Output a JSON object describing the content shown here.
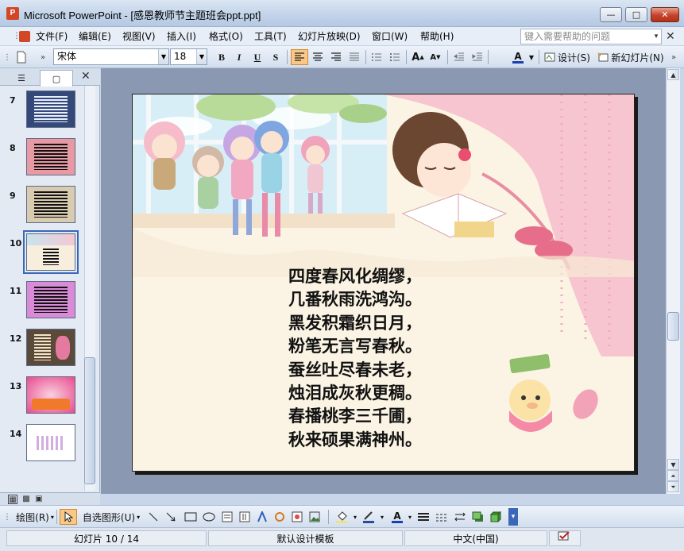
{
  "window": {
    "title": "Microsoft PowerPoint - [感恩教师节主题班会ppt.ppt]",
    "app_icon_letter": "P",
    "minimize": "—",
    "maximize": "□",
    "close": "✕"
  },
  "menu": {
    "items": [
      "文件(F)",
      "编辑(E)",
      "视图(V)",
      "插入(I)",
      "格式(O)",
      "工具(T)",
      "幻灯片放映(D)",
      "窗口(W)",
      "帮助(H)"
    ],
    "help_placeholder": "键入需要帮助的问题",
    "help_dropdown": "▾",
    "doc_close": "✕"
  },
  "format_toolbar": {
    "font": "宋体",
    "size": "18",
    "bold": "B",
    "italic": "I",
    "underline": "U",
    "shadow": "S",
    "grow": "A",
    "shrink": "A",
    "font_color": "A",
    "design": "设计(S)",
    "new_slide": "新幻灯片(N)"
  },
  "left_panel": {
    "tab_outline": "☰",
    "tab_slides": "▢",
    "close": "✕",
    "thumbnails": [
      {
        "number": "7",
        "bg": "#34497a"
      },
      {
        "number": "8",
        "bg": "#e89aa4"
      },
      {
        "number": "9",
        "bg": "#d9cbb0"
      },
      {
        "number": "10",
        "bg": "#f7eede",
        "selected": true
      },
      {
        "number": "11",
        "bg": "#d98bd8"
      },
      {
        "number": "12",
        "bg": "#5b4a3a"
      },
      {
        "number": "13",
        "bg": "#e84a8e"
      },
      {
        "number": "14",
        "bg": "#ffffff"
      }
    ]
  },
  "slide": {
    "poem": [
      "四度春风化绸缪，",
      "几番秋雨洗鸿沟。",
      "黑发积霜织日月，",
      "粉笔无言写春秋。",
      "蚕丝吐尽春未老，",
      "烛泪成灰秋更稠。",
      "春播桃李三千圃，",
      "秋来硕果满神州。"
    ]
  },
  "draw_toolbar": {
    "draw": "绘图(R)",
    "autoshapes": "自选图形(U)"
  },
  "status": {
    "slide": "幻灯片 10 / 14",
    "template": "默认设计模板",
    "language": "中文(中国)"
  },
  "colors": {
    "accent": "#3b67b8",
    "title_bar": "#c3d4ea",
    "slide_pane": "#8b98b2"
  }
}
